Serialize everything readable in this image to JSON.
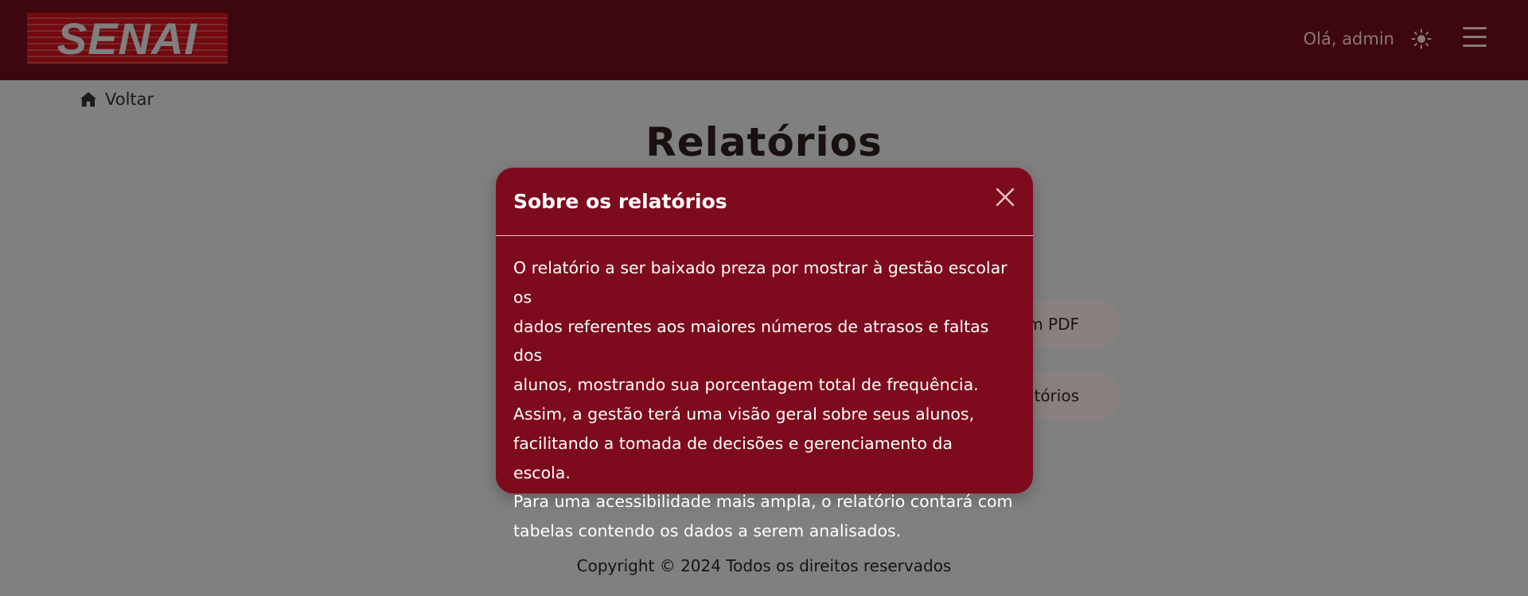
{
  "header": {
    "logo_text": "SENAI",
    "greeting": "Olá, admin",
    "theme_icon": "sun-icon",
    "menu_icon": "hamburger-menu-icon",
    "background": "#3e060e"
  },
  "nav": {
    "back_label": "Voltar",
    "back_icon": "home-icon"
  },
  "page": {
    "title": "Relatórios",
    "button_pdf_partial": "em PDF",
    "button_about_partial": "atórios"
  },
  "modal": {
    "title": "Sobre os relatórios",
    "close_icon": "close-icon",
    "body_lines": [
      "O relatório a ser baixado preza por mostrar à gestão escolar os",
      "dados referentes aos maiores números de atrasos e faltas dos",
      "alunos, mostrando sua porcentagem total de frequência.",
      "Assim, a gestão terá uma visão geral sobre seus alunos,",
      "facilitando a tomada de decisões e gerenciamento da escola.",
      "Para uma acessibilidade mais ampla, o relatório contará com",
      "tabelas contendo os dados a serem analisados."
    ],
    "background": "#7d0b1d"
  },
  "footer": {
    "copyright": "Copyright © 2024 Todos os direitos reservados"
  }
}
